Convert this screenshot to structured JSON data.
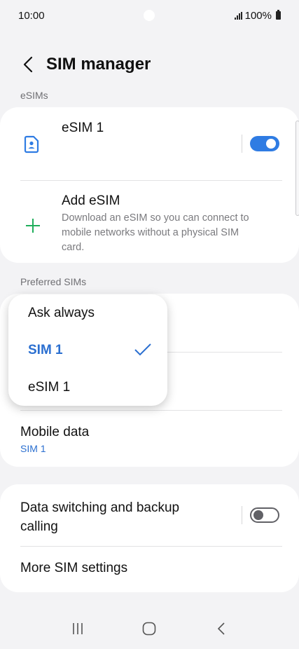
{
  "status_bar": {
    "time": "10:00",
    "battery": "100%"
  },
  "header": {
    "title": "SIM manager"
  },
  "esims": {
    "section_label": "eSIMs",
    "items": [
      {
        "title": "eSIM 1",
        "toggle": "on",
        "icon": "sim-card-icon"
      }
    ],
    "add": {
      "title": "Add eSIM",
      "description_lines": [
        "Download an eSIM so you can connect to",
        "mobile networks without a physical SIM",
        "card."
      ],
      "icon": "plus-icon"
    }
  },
  "preferred": {
    "section_label": "Preferred SIMs",
    "mobile_data": {
      "title": "Mobile data",
      "value": "SIM 1"
    }
  },
  "dropdown": {
    "options": [
      {
        "label": "Ask always",
        "selected": false
      },
      {
        "label": "SIM 1",
        "selected": true
      },
      {
        "label": "eSIM 1",
        "selected": false
      }
    ]
  },
  "settings": {
    "data_switching": {
      "title_lines": [
        "Data switching and backup",
        "calling"
      ],
      "toggle": "off"
    },
    "more": {
      "title": "More SIM settings"
    }
  },
  "colors": {
    "accent": "#2f7ce3",
    "plus_green": "#1fae5b",
    "background": "#f3f3f5"
  }
}
